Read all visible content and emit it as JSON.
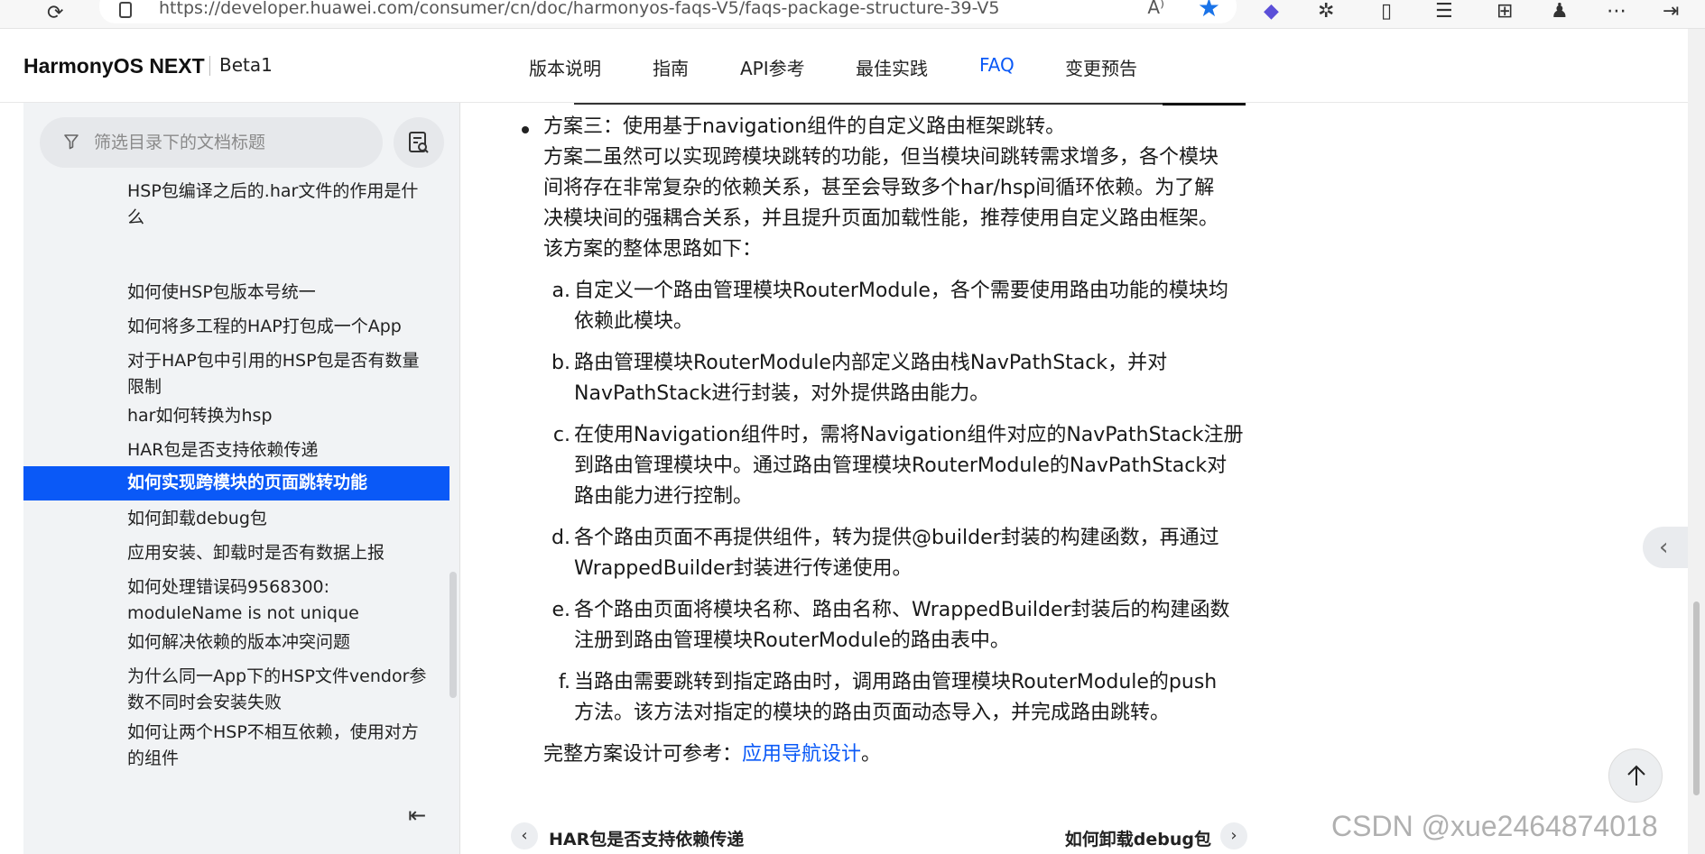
{
  "browser": {
    "url": "https://developer.huawei.com/consumer/cn/doc/harmonyos-faqs-V5/faqs-package-structure-39-V5",
    "read_aloud_label": "A⁾"
  },
  "header": {
    "brand": "HarmonyOS NEXT",
    "version": "Beta1",
    "tabs": [
      {
        "label": "版本说明"
      },
      {
        "label": "指南"
      },
      {
        "label": "API参考"
      },
      {
        "label": "最佳实践"
      },
      {
        "label": "FAQ"
      },
      {
        "label": "变更预告"
      }
    ],
    "active_tab": "FAQ"
  },
  "sidebar": {
    "search_placeholder": "筛选目录下的文档标题",
    "items": [
      {
        "label": "HSP包编译之后的.har文件的作用是什么"
      },
      {
        "label": "如何使HSP包版本号统一"
      },
      {
        "label": "如何将多工程的HAP打包成一个App"
      },
      {
        "label": "对于HAP包中引用的HSP包是否有数量限制"
      },
      {
        "label": "har如何转换为hsp"
      },
      {
        "label": "HAR包是否支持依赖传递"
      },
      {
        "label": "如何实现跨模块的页面跳转功能"
      },
      {
        "label": "如何卸载debug包"
      },
      {
        "label": "应用安装、卸载时是否有数据上报"
      },
      {
        "label": "如何处理错误码9568300: moduleName is not unique"
      },
      {
        "label": "如何解决依赖的版本冲突问题"
      },
      {
        "label": "为什么同一App下的HSP文件vendor参数不同时会安装失败"
      },
      {
        "label": "如何让两个HSP不相互依赖，使用对方的组件"
      }
    ]
  },
  "content": {
    "scheme3_title": "方案三：使用基于navigation组件的自定义路由框架跳转。",
    "intro_lines": [
      "方案二虽然可以实现跨模块跳转的功能，但当模块间跳转需求增多，各个模块",
      "间将存在非常复杂的依赖关系，甚至会导致多个har/hsp间循环依赖。为了解",
      "决模块间的强耦合关系，并且提升页面加载性能，推荐使用自定义路由框架。",
      "该方案的整体思路如下："
    ],
    "steps": [
      {
        "letter": "a.",
        "lines": [
          "自定义一个路由管理模块RouterModule，各个需要使用路由功能的模块均",
          "依赖此模块。"
        ]
      },
      {
        "letter": "b.",
        "lines": [
          "路由管理模块RouterModule内部定义路由栈NavPathStack，并对",
          "NavPathStack进行封装，对外提供路由能力。"
        ]
      },
      {
        "letter": "c.",
        "lines": [
          "在使用Navigation组件时，需将Navigation组件对应的NavPathStack注册",
          "到路由管理模块中。通过路由管理模块RouterModule的NavPathStack对",
          "路由能力进行控制。"
        ]
      },
      {
        "letter": "d.",
        "lines": [
          "各个路由页面不再提供组件，转为提供@builder封装的构建函数，再通过",
          "WrappedBuilder封装进行传递使用。"
        ]
      },
      {
        "letter": "e.",
        "lines": [
          "各个路由页面将模块名称、路由名称、WrappedBuilder封装后的构建函数",
          "注册到路由管理模块RouterModule的路由表中。"
        ]
      },
      {
        "letter": "f.",
        "lines": [
          "当路由需要跳转到指定路由时，调用路由管理模块RouterModule的push",
          "方法。该方法对指定的模块的路由页面动态导入，并完成路由跳转。"
        ]
      }
    ],
    "reference_prefix": "完整方案设计可参考：",
    "reference_link": "应用导航设计",
    "reference_suffix": "。"
  },
  "pager": {
    "prev_label": "HAR包是否支持依赖传递",
    "next_label": "如何卸载debug包"
  },
  "watermark": "CSDN @xue2464874018",
  "colors": {
    "accent": "#0a59f7",
    "sidebar_bg": "#f1f3f5"
  }
}
